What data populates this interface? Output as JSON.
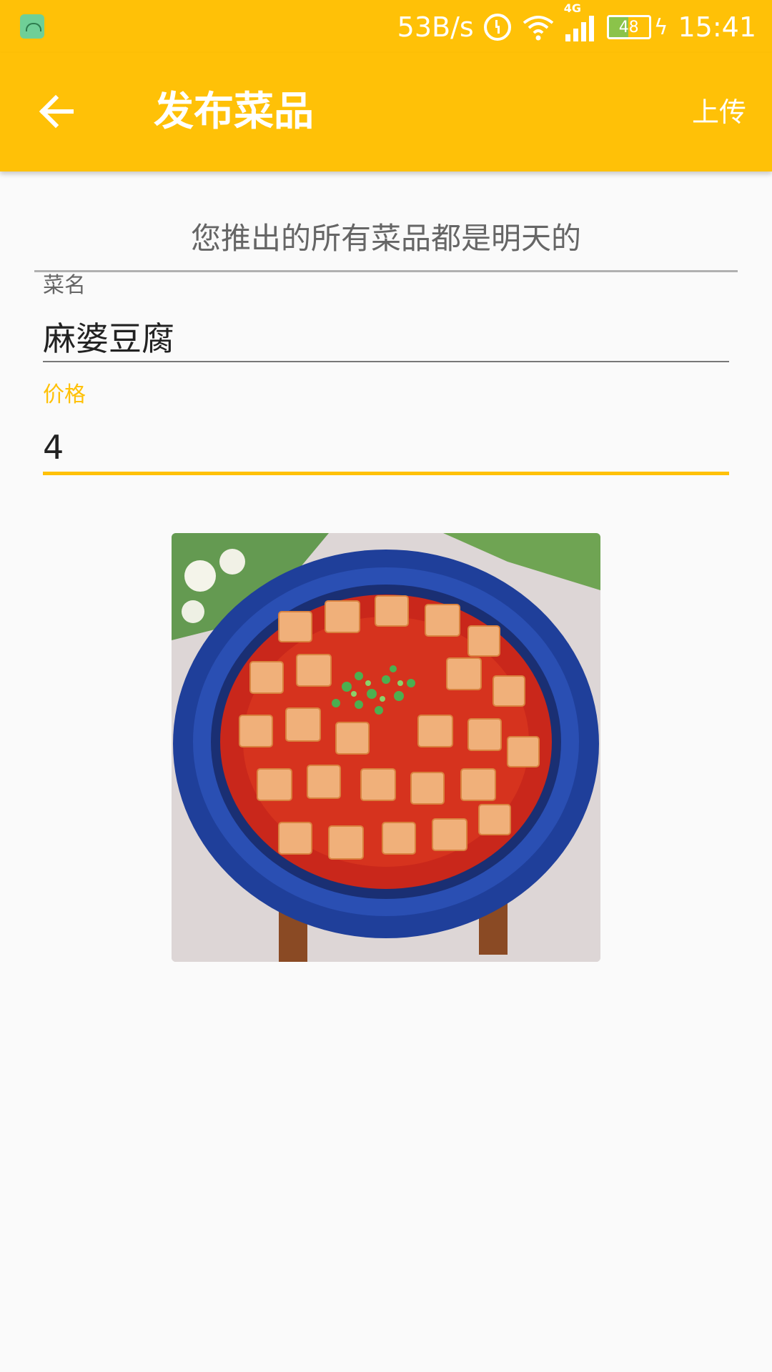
{
  "status_bar": {
    "net_speed": "53B/s",
    "network_type": "4G",
    "battery_level": "48",
    "battery_fraction": 0.48,
    "time": "15:41",
    "icons": [
      "android-icon",
      "alarm-icon",
      "wifi-icon",
      "signal-icon",
      "battery-icon",
      "charging-icon"
    ]
  },
  "app_bar": {
    "title": "发布菜品",
    "back_icon": "arrow-back-icon",
    "upload_label": "上传",
    "background_color": "#FFC107"
  },
  "form": {
    "notice": "您推出的所有菜品都是明天的",
    "dish_name": {
      "label": "菜名",
      "value": "麻婆豆腐"
    },
    "price": {
      "label": "价格",
      "value": "4",
      "focused": true
    }
  },
  "photo": {
    "name": "dish-photo",
    "depicts": "麻婆豆腐"
  },
  "colors": {
    "accent": "#FFC107",
    "text_primary": "#222222",
    "text_secondary": "#666666",
    "background": "#FAFAFA"
  }
}
